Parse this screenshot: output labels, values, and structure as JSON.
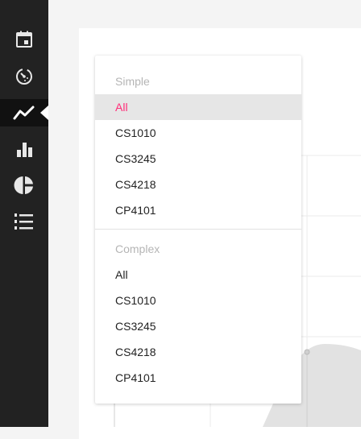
{
  "sidebar": {
    "items": [
      {
        "icon": "calendar-icon",
        "active": false
      },
      {
        "icon": "timer-icon",
        "active": false
      },
      {
        "icon": "line-chart-icon",
        "active": true
      },
      {
        "icon": "bar-chart-icon",
        "active": false
      },
      {
        "icon": "pie-chart-icon",
        "active": false
      },
      {
        "icon": "numbered-list-icon",
        "active": false
      }
    ]
  },
  "dropdown": {
    "groups": [
      {
        "header": "Simple",
        "items": [
          "All",
          "CS1010",
          "CS3245",
          "CS4218",
          "CP4101"
        ],
        "selected": 0
      },
      {
        "header": "Complex",
        "items": [
          "All",
          "CS1010",
          "CS3245",
          "CS4218",
          "CP4101"
        ]
      }
    ]
  },
  "colors": {
    "sidebar": "#222222",
    "accent": "#ff2d78",
    "selected_bg": "#e6e6e6",
    "header_text": "#b5b5b5"
  }
}
